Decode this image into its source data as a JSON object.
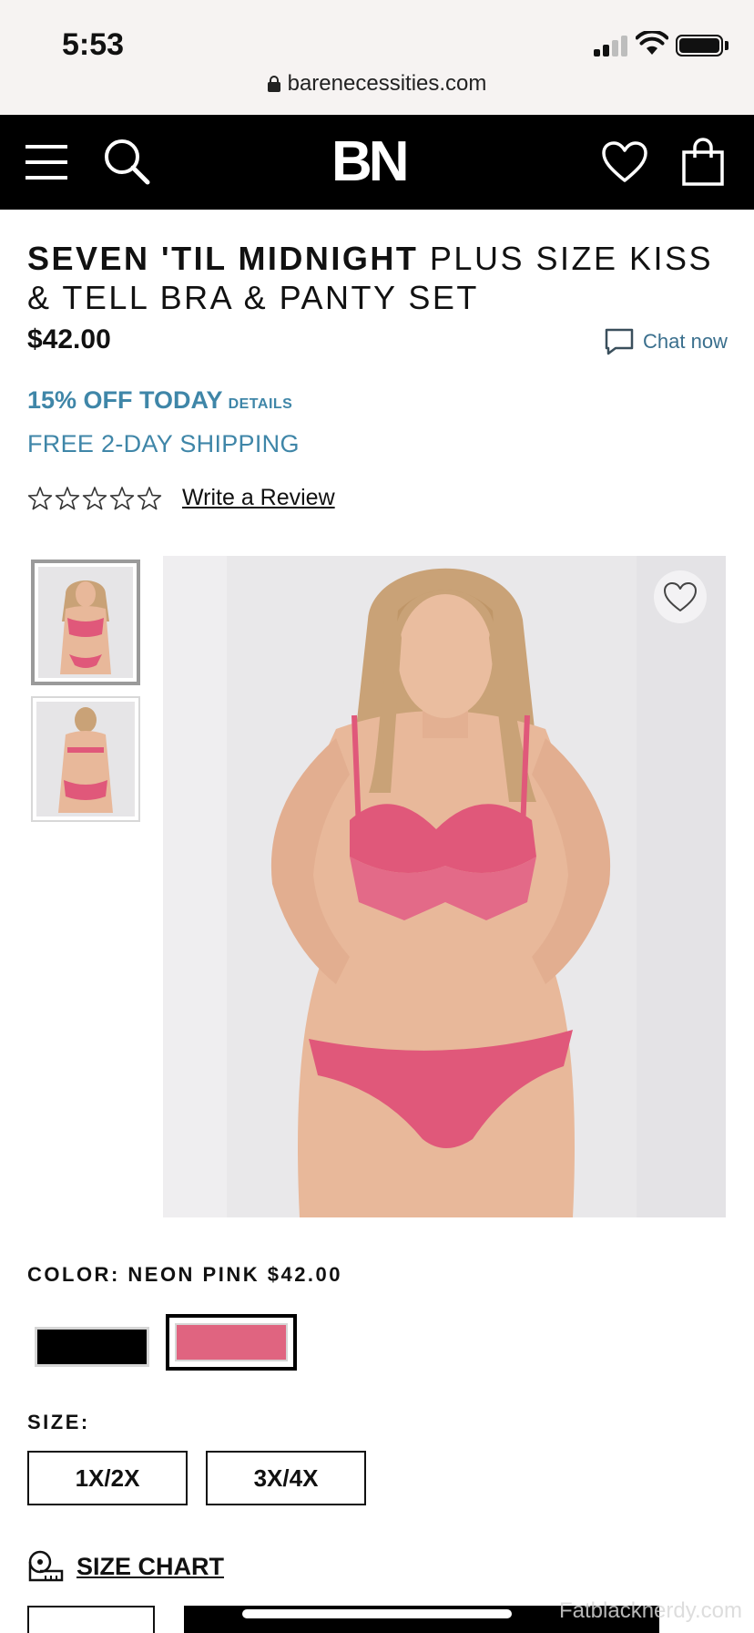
{
  "status_bar": {
    "time": "5:53",
    "url": "barenecessities.com"
  },
  "navbar": {
    "logo": "BN"
  },
  "product": {
    "brand": "SEVEN 'TIL MIDNIGHT",
    "name": " PLUS SIZE KISS & TELL BRA & PANTY SET",
    "price": "$42.00",
    "promo": "15% OFF TODAY",
    "promo_details": "DETAILS",
    "shipping": "FREE 2-DAY SHIPPING",
    "rating": {
      "stars_filled": 0,
      "stars_total": 5
    },
    "review_link": "Write a Review"
  },
  "chat": {
    "label": "Chat now"
  },
  "colors": {
    "label": "COLOR: NEON PINK  $42.00",
    "swatches": [
      {
        "name": "Black",
        "hex": "#000000",
        "selected": false
      },
      {
        "name": "Neon Pink",
        "hex": "#e06480",
        "selected": true
      }
    ]
  },
  "sizes": {
    "label": "SIZE:",
    "options": [
      "1X/2X",
      "3X/4X"
    ]
  },
  "size_chart": {
    "label": "SIZE CHART"
  },
  "watermark": "Fatblacknerdy.com",
  "theme": {
    "accent": "#3f86a8",
    "chat": "#3a6f8d",
    "lace": "#e0587a",
    "skin": "#e8b89a",
    "hair": "#c9a277"
  }
}
